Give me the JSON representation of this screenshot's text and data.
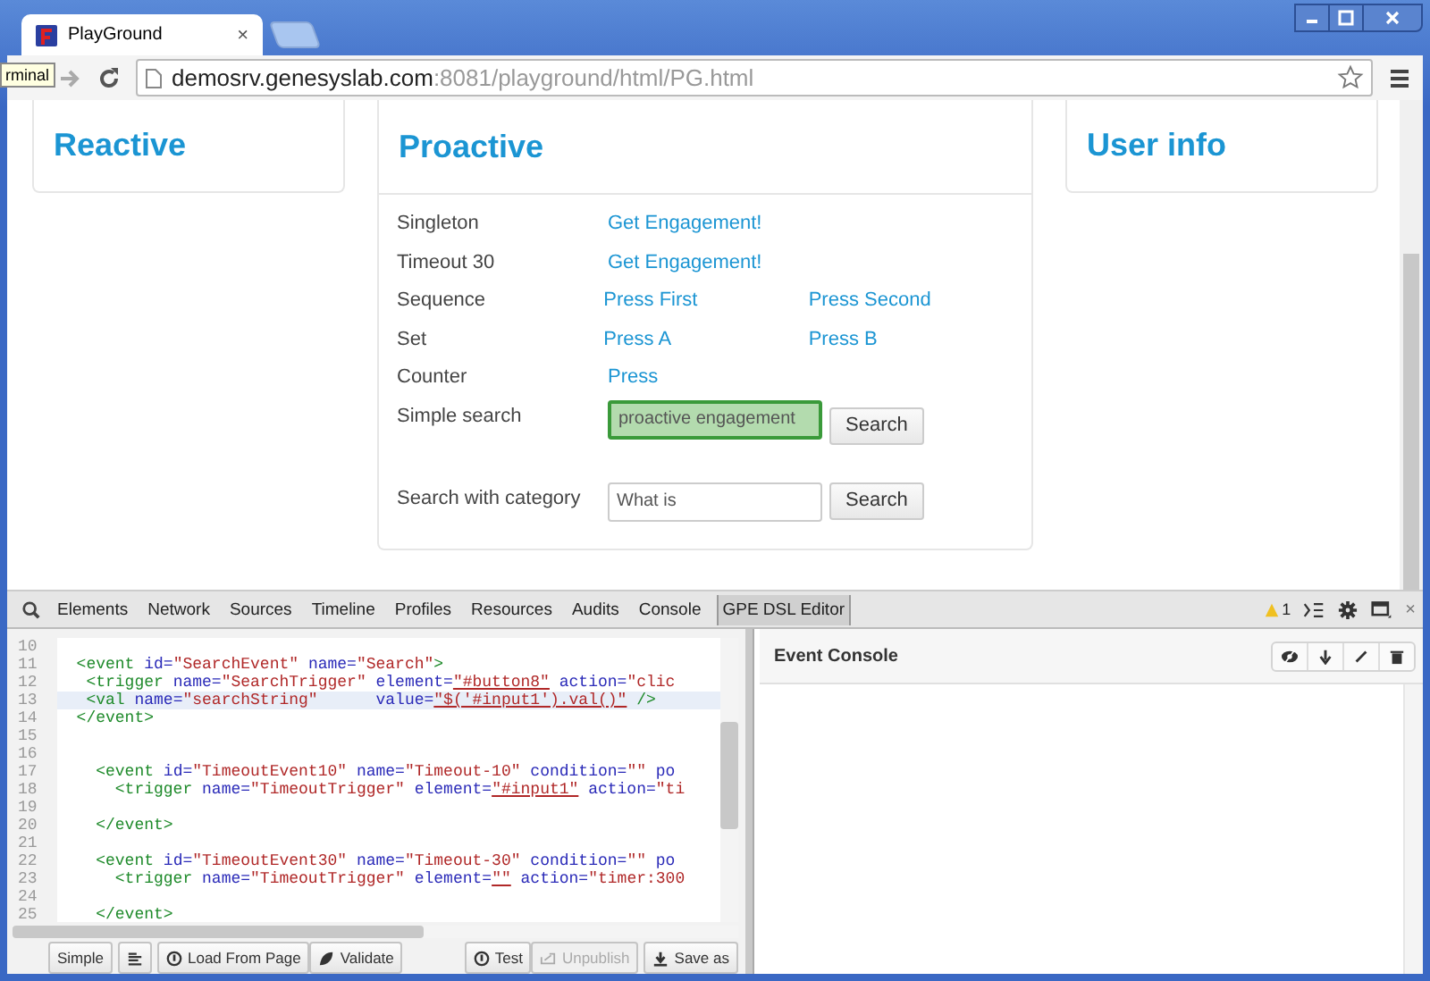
{
  "browser": {
    "tab": {
      "title": "PlayGround",
      "close": "×"
    },
    "address": {
      "host": "demosrv.genesyslab.com",
      "path": ":8081/playground/html/PG.html"
    },
    "tooltip": "rminal"
  },
  "page": {
    "cards": [
      {
        "title": "Reactive"
      },
      {
        "title": "Proactive"
      },
      {
        "title": "User info"
      }
    ],
    "rows": [
      {
        "kind": "links",
        "label": "Singleton",
        "actions": [
          "Get Engagement!"
        ]
      },
      {
        "kind": "links",
        "label": "Timeout 30",
        "actions": [
          "Get Engagement!"
        ]
      },
      {
        "kind": "links",
        "label": "Sequence",
        "actions": [
          "Press First",
          "Press Second"
        ]
      },
      {
        "kind": "links",
        "label": "Set",
        "actions": [
          "Press A",
          "Press B"
        ]
      },
      {
        "kind": "links",
        "label": "Counter",
        "actions": [
          "Press"
        ]
      },
      {
        "kind": "search",
        "label": "Simple search",
        "value": "proactive engagement",
        "highlighted": true,
        "button": "Search"
      },
      {
        "kind": "search",
        "label": "Search with category",
        "value": "What is",
        "highlighted": false,
        "button": "Search"
      }
    ]
  },
  "devtools": {
    "tabs": [
      {
        "label": "Elements",
        "selected": false
      },
      {
        "label": "Network",
        "selected": false
      },
      {
        "label": "Sources",
        "selected": false
      },
      {
        "label": "Timeline",
        "selected": false
      },
      {
        "label": "Profiles",
        "selected": false
      },
      {
        "label": "Resources",
        "selected": false
      },
      {
        "label": "Audits",
        "selected": false
      },
      {
        "label": "Console",
        "selected": false
      },
      {
        "label": "GPE DSL Editor",
        "selected": true
      }
    ],
    "warnings": "1",
    "close": "×",
    "editor": {
      "lines": [
        {
          "num": "10",
          "current": false
        },
        {
          "num": "11",
          "current": false,
          "tokens": [
            {
              "kind": "tag",
              "text": "  <event"
            },
            {
              "kind": "attr",
              "text": " id="
            },
            {
              "kind": "value",
              "text": "\"SearchEvent\""
            },
            {
              "kind": "attr",
              "text": " name="
            },
            {
              "kind": "value",
              "text": "\"Search\""
            },
            {
              "kind": "tag",
              "text": ">"
            }
          ]
        },
        {
          "num": "12",
          "current": false,
          "tokens": [
            {
              "kind": "tag",
              "text": "   <trigger"
            },
            {
              "kind": "attr",
              "text": " name="
            },
            {
              "kind": "value",
              "text": "\"SearchTrigger\""
            },
            {
              "kind": "attr",
              "text": " element="
            },
            {
              "kind": "link",
              "text": "\"#button8\""
            },
            {
              "kind": "attr",
              "text": " action="
            },
            {
              "kind": "value",
              "text": "\"clic"
            }
          ]
        },
        {
          "num": "13",
          "current": true,
          "tokens": [
            {
              "kind": "tag",
              "text": "   <val"
            },
            {
              "kind": "attr",
              "text": " name="
            },
            {
              "kind": "value",
              "text": "\"searchString\""
            },
            {
              "kind": "attr",
              "text": "      value="
            },
            {
              "kind": "link",
              "text": "\"$('#input1').val()\""
            },
            {
              "kind": "tag",
              "text": " />"
            }
          ]
        },
        {
          "num": "14",
          "current": false,
          "tokens": [
            {
              "kind": "tag",
              "text": "  </event>"
            }
          ]
        },
        {
          "num": "15",
          "current": false
        },
        {
          "num": "16",
          "current": false
        },
        {
          "num": "17",
          "current": false,
          "tokens": [
            {
              "kind": "tag",
              "text": "    <event"
            },
            {
              "kind": "attr",
              "text": " id="
            },
            {
              "kind": "value",
              "text": "\"TimeoutEvent10\""
            },
            {
              "kind": "attr",
              "text": " name="
            },
            {
              "kind": "value",
              "text": "\"Timeout-10\""
            },
            {
              "kind": "attr",
              "text": " condition="
            },
            {
              "kind": "value",
              "text": "\"\""
            },
            {
              "kind": "attr",
              "text": " po"
            }
          ]
        },
        {
          "num": "18",
          "current": false,
          "tokens": [
            {
              "kind": "tag",
              "text": "      <trigger"
            },
            {
              "kind": "attr",
              "text": " name="
            },
            {
              "kind": "value",
              "text": "\"TimeoutTrigger\""
            },
            {
              "kind": "attr",
              "text": " element="
            },
            {
              "kind": "link",
              "text": "\"#input1\""
            },
            {
              "kind": "attr",
              "text": " action="
            },
            {
              "kind": "value",
              "text": "\"ti"
            }
          ]
        },
        {
          "num": "19",
          "current": false
        },
        {
          "num": "20",
          "current": false,
          "tokens": [
            {
              "kind": "tag",
              "text": "    </event>"
            }
          ]
        },
        {
          "num": "21",
          "current": false
        },
        {
          "num": "22",
          "current": false,
          "tokens": [
            {
              "kind": "tag",
              "text": "    <event"
            },
            {
              "kind": "attr",
              "text": " id="
            },
            {
              "kind": "value",
              "text": "\"TimeoutEvent30\""
            },
            {
              "kind": "attr",
              "text": " name="
            },
            {
              "kind": "value",
              "text": "\"Timeout-30\""
            },
            {
              "kind": "attr",
              "text": " condition="
            },
            {
              "kind": "value",
              "text": "\"\""
            },
            {
              "kind": "attr",
              "text": " po"
            }
          ]
        },
        {
          "num": "23",
          "current": false,
          "tokens": [
            {
              "kind": "tag",
              "text": "      <trigger"
            },
            {
              "kind": "attr",
              "text": " name="
            },
            {
              "kind": "value",
              "text": "\"TimeoutTrigger\""
            },
            {
              "kind": "attr",
              "text": " element="
            },
            {
              "kind": "link",
              "text": "\"\""
            },
            {
              "kind": "attr",
              "text": " action="
            },
            {
              "kind": "value",
              "text": "\"timer:300"
            }
          ]
        },
        {
          "num": "24",
          "current": false
        },
        {
          "num": "25",
          "current": false,
          "tokens": [
            {
              "kind": "tag",
              "text": "    </event>"
            }
          ]
        }
      ],
      "button_groups": [
        [
          {
            "label": "Simple",
            "disabled": false
          }
        ],
        [
          {
            "disabled": false
          }
        ],
        [
          {
            "label": "Load From Page",
            "disabled": false
          },
          {
            "label": "Validate",
            "disabled": false
          }
        ],
        [
          {
            "label": "Test",
            "disabled": false
          },
          {
            "label": "Unpublish",
            "disabled": true
          }
        ],
        [
          {
            "label": "Save as",
            "disabled": false
          }
        ]
      ]
    },
    "console": {
      "title": "Event Console"
    }
  }
}
